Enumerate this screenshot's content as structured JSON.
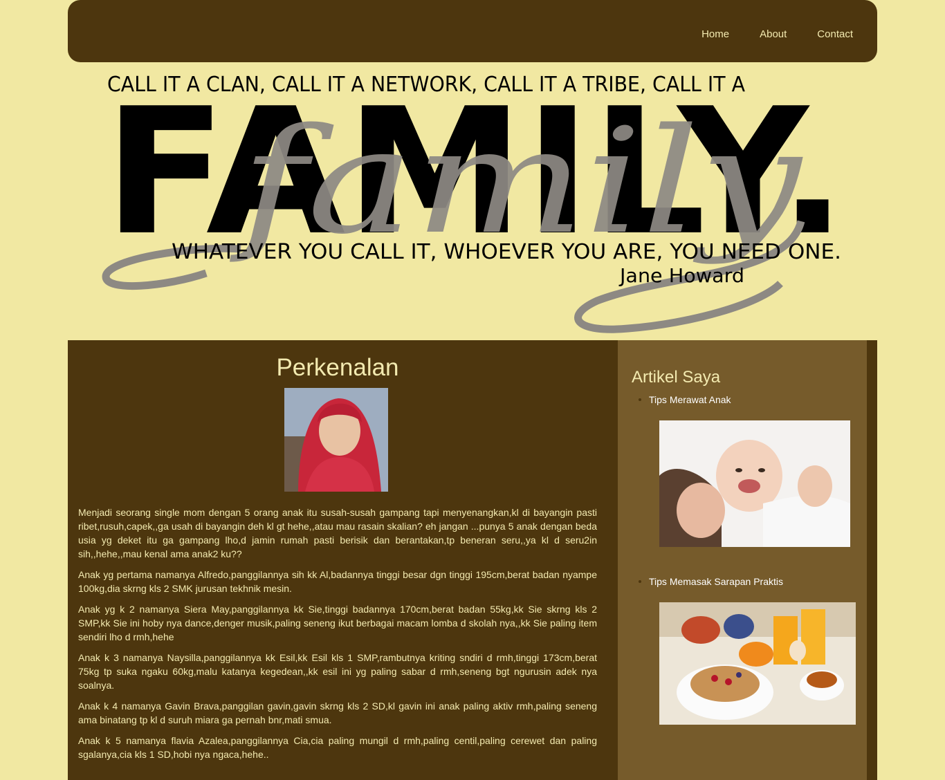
{
  "nav": {
    "items": [
      "Home",
      "About",
      "Contact"
    ]
  },
  "banner": {
    "line1": "CALL IT A CLAN, CALL IT A NETWORK, CALL IT A TRIBE, CALL IT A",
    "big": "FAMILY.",
    "script": "family",
    "line2": "WHATEVER YOU CALL IT, WHOEVER YOU ARE, YOU NEED ONE.",
    "author": "Jane Howard"
  },
  "main": {
    "title": "Perkenalan",
    "paragraphs": [
      "Menjadi seorang single mom dengan 5 orang anak itu susah-susah gampang tapi menyenangkan,kl di bayangin pasti ribet,rusuh,capek,,ga usah di bayangin deh kl gt hehe,,atau mau rasain skalian? eh jangan ...punya 5 anak dengan beda usia yg deket itu ga gampang lho,d jamin rumah pasti berisik dan berantakan,tp beneran seru,,ya kl d seru2in sih,,hehe,,mau kenal ama anak2 ku??",
      "Anak yg pertama namanya Alfredo,panggilannya sih kk Al,badannya tinggi besar dgn tinggi 195cm,berat badan nyampe 100kg,dia skrng kls 2 SMK jurusan tekhnik mesin.",
      "Anak yg k 2 namanya Siera May,panggilannya kk Sie,tinggi badannya 170cm,berat badan 55kg,kk Sie skrng kls 2 SMP,kk Sie ini hoby nya dance,denger musik,paling seneng ikut berbagai macam lomba d skolah nya,,kk Sie paling item sendiri lho d rmh,hehe",
      "Anak k 3 namanya Naysilla,panggilannya kk Esil,kk Esil kls 1 SMP,rambutnya kriting sndiri d rmh,tinggi 173cm,berat 75kg tp suka ngaku 60kg,malu katanya kegedean,,kk esil ini yg paling sabar d rmh,seneng bgt ngurusin adek nya soalnya.",
      "Anak k 4 namanya Gavin Brava,panggilan gavin,gavin skrng kls 2 SD,kl gavin ini anak paling aktiv rmh,paling seneng ama binatang tp kl d suruh miara ga pernah bnr,mati smua.",
      "Anak k 5 namanya flavia Azalea,panggilannya Cia,cia paling mungil d rmh,paling centil,paling cerewet dan paling sgalanya,cia kls 1 SD,hobi nya ngaca,hehe.."
    ]
  },
  "sidebar": {
    "title": "Artikel Saya",
    "articles": [
      {
        "label": "Tips Merawat Anak"
      },
      {
        "label": "Tips Memasak Sarapan Praktis"
      }
    ]
  }
}
